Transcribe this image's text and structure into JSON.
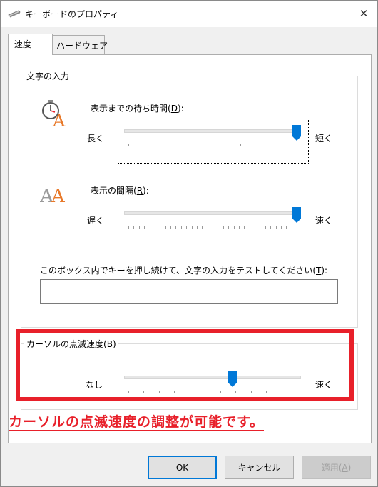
{
  "window": {
    "title": "キーボードのプロパティ",
    "close_glyph": "✕"
  },
  "tabs": [
    {
      "label": "速度",
      "active": true
    },
    {
      "label": "ハードウェア",
      "active": false
    }
  ],
  "char_input": {
    "group_label": "文字の入力",
    "delay": {
      "label": "表示までの待ち時間",
      "accel": "D",
      "left": "長く",
      "right": "短く",
      "level": 1.0
    },
    "rate": {
      "label": "表示の間隔",
      "accel": "R",
      "left": "遅く",
      "right": "速く",
      "level": 1.0
    },
    "test": {
      "label": "このボックス内でキーを押し続けて、文字の入力をテストしてください",
      "accel": "T",
      "value": ""
    }
  },
  "cursor_blink": {
    "group_label": "カーソルの点滅速度",
    "accel": "B",
    "left": "なし",
    "right": "速く",
    "level": 0.62
  },
  "annotation": {
    "text": "カーソルの点滅速度の調整が可能です。",
    "color": "#e8202a"
  },
  "buttons": {
    "ok": "OK",
    "cancel": "キャンセル",
    "apply": "適用",
    "apply_accel": "A"
  },
  "colors": {
    "thumb": "#0078d7",
    "highlight": "#e8202a",
    "icon_orange": "#e8792a"
  }
}
